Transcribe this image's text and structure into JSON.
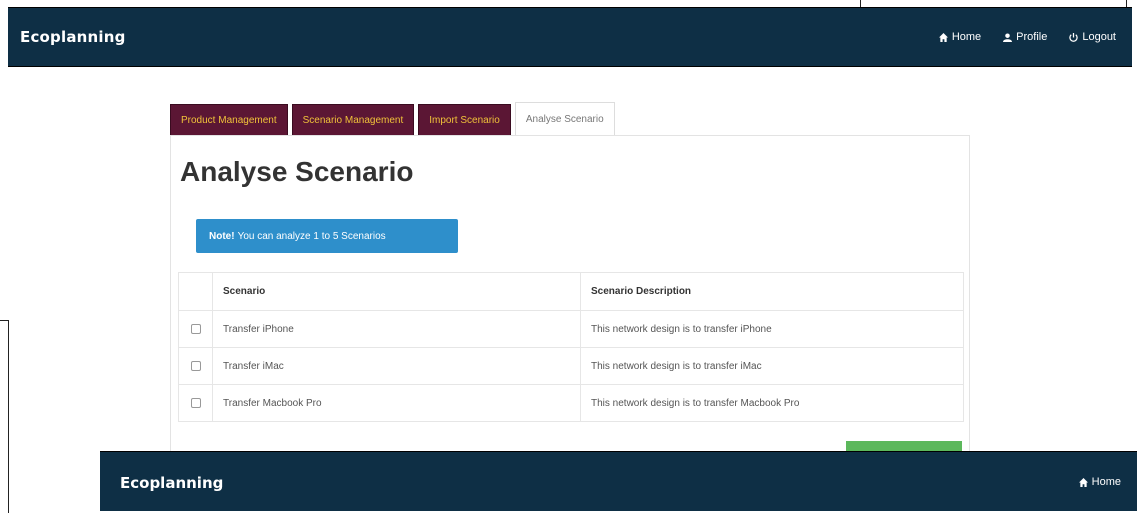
{
  "app": {
    "brand": "Ecoplanning"
  },
  "nav": [
    {
      "label": "Home",
      "icon": "home-icon"
    },
    {
      "label": "Profile",
      "icon": "user-icon"
    },
    {
      "label": "Logout",
      "icon": "power-icon"
    }
  ],
  "tabs": [
    {
      "label": "Product Management",
      "active": false
    },
    {
      "label": "Scenario Management",
      "active": false
    },
    {
      "label": "Import Scenario",
      "active": false
    },
    {
      "label": "Analyse Scenario",
      "active": true
    }
  ],
  "page": {
    "title": "Analyse Scenario",
    "note_strong": "Note!",
    "note_text": "You can analyze 1 to 5 Scenarios"
  },
  "table": {
    "headers": [
      "Scenario",
      "Scenario Description"
    ],
    "rows": [
      {
        "scenario": "Transfer iPhone",
        "description": "This network design is to transfer iPhone"
      },
      {
        "scenario": "Transfer iMac",
        "description": "This network design is to transfer iMac"
      },
      {
        "scenario": "Transfer Macbook Pro",
        "description": "This network design is to transfer Macbook Pro"
      }
    ]
  },
  "second": {
    "brand": "Ecoplanning",
    "home_label": "Home"
  },
  "colors": {
    "navbar": "#0e2f45",
    "tab_dark": "#5b1634",
    "tab_text": "#f0c23a",
    "note": "#2e8fcb",
    "button": "#5cb85c"
  }
}
